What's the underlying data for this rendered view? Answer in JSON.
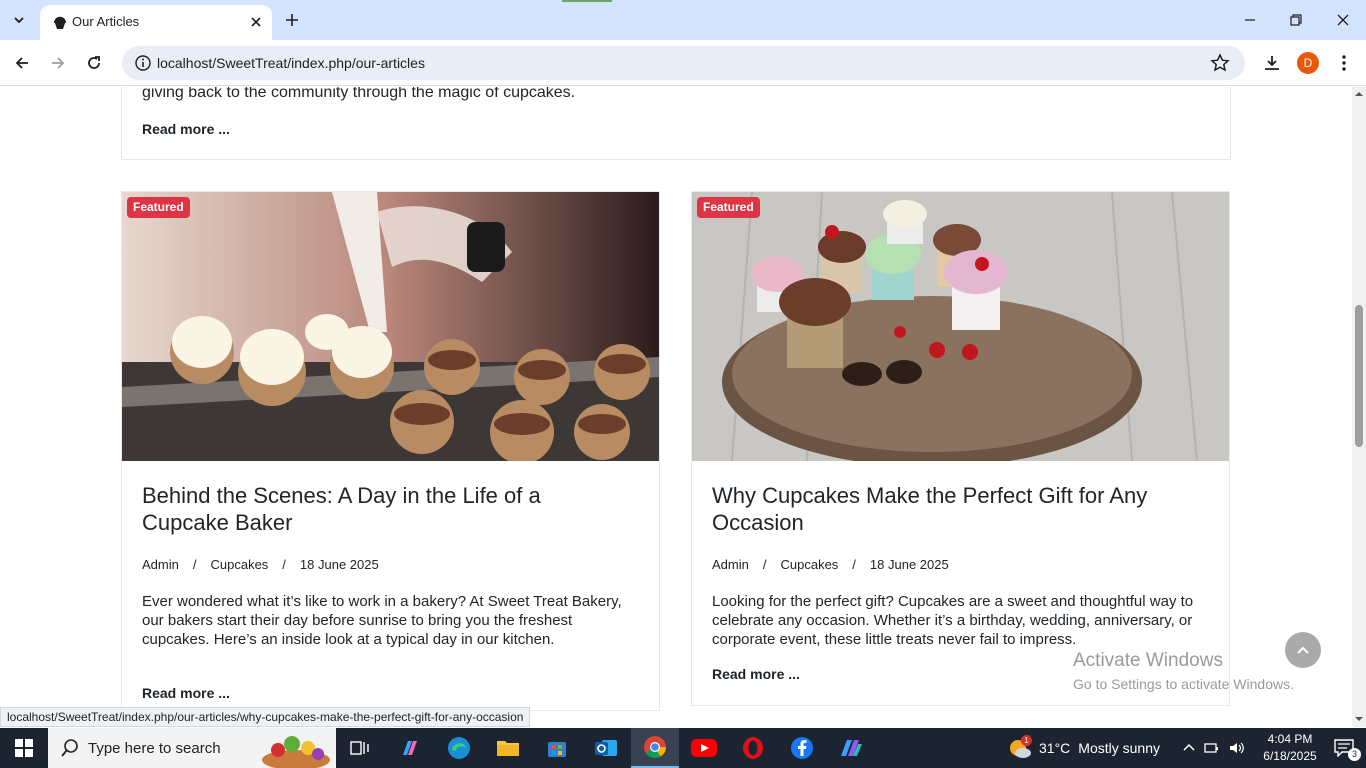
{
  "browser": {
    "tab_title": "Our Articles",
    "url": "localhost/SweetTreat/index.php/our-articles",
    "profile_initial": "D",
    "status_url": "localhost/SweetTreat/index.php/our-articles/why-cupcakes-make-the-perfect-gift-for-any-occasion"
  },
  "prev_article": {
    "text": "giving back to the community through the magic of cupcakes.",
    "read_more": "Read more ..."
  },
  "articles": [
    {
      "badge": "Featured",
      "title": "Behind the Scenes: A Day in the Life of a Cupcake Baker",
      "author": "Admin",
      "category": "Cupcakes",
      "date": "18 June 2025",
      "excerpt": "Ever wondered what it’s like to work in a bakery? At Sweet Treat Bakery, our bakers start their day before sunrise to bring you the freshest cupcakes. Here’s an inside look at a typical day in our kitchen.",
      "read_more": "Read more ..."
    },
    {
      "badge": "Featured",
      "title": "Why Cupcakes Make the Perfect Gift for Any Occasion",
      "author": "Admin",
      "category": "Cupcakes",
      "date": "18 June 2025",
      "excerpt": "Looking for the perfect gift? Cupcakes are a sweet and thoughtful way to celebrate any occasion. Whether it’s a birthday, wedding, anniversary, or corporate event, these little treats never fail to impress.",
      "read_more": "Read more ..."
    }
  ],
  "separator": "/",
  "watermark": {
    "title": "Activate Windows",
    "subtitle": "Go to Settings to activate Windows."
  },
  "taskbar": {
    "search_placeholder": "Type here to search",
    "weather_temp": "31°C",
    "weather_text": "Mostly sunny",
    "time": "4:04 PM",
    "date": "6/18/2025",
    "notification_count": "3",
    "weather_badge": "1"
  },
  "colors": {
    "badge": "#dc3545",
    "tab_strip": "#d3e3fd",
    "taskbar": "#1c2331"
  }
}
